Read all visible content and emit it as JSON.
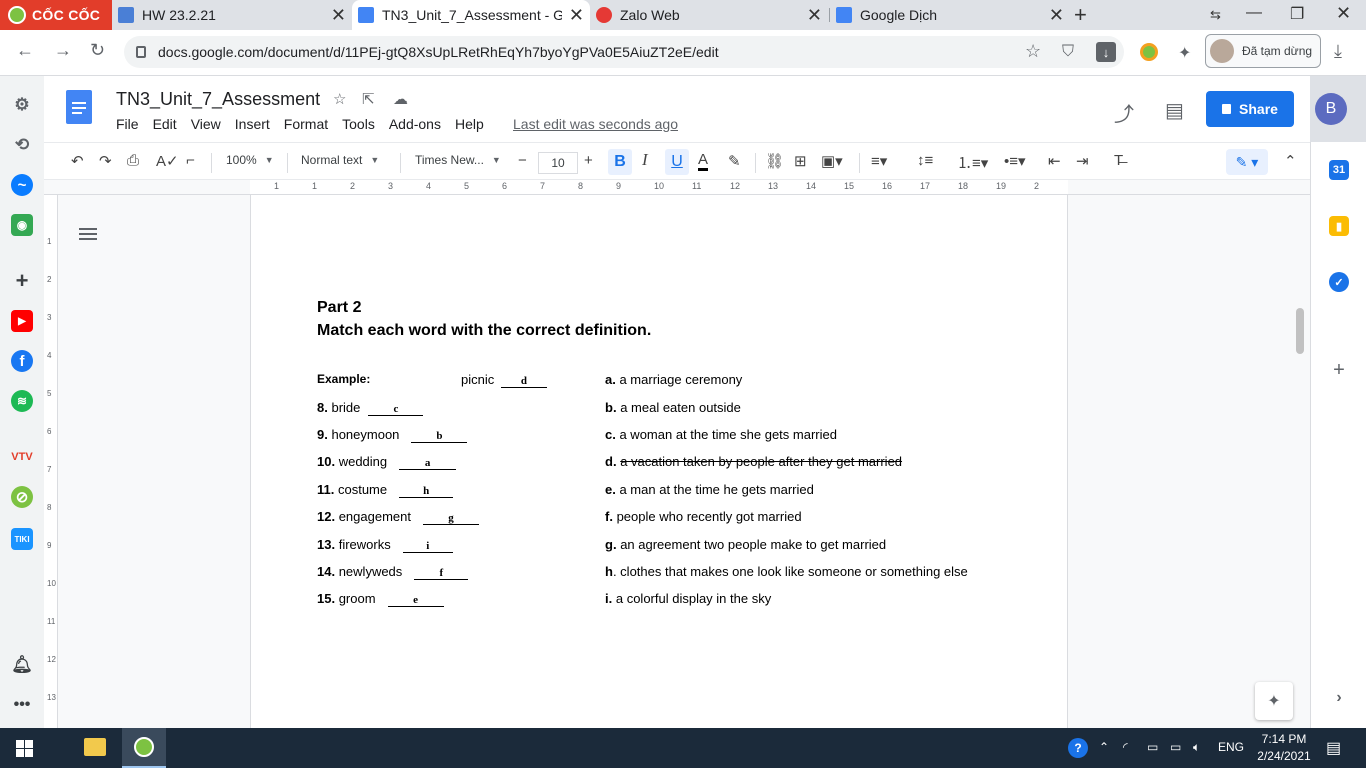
{
  "browser": {
    "brand": "CỐC CỐC",
    "tabs": [
      {
        "title": "HW 23.2.21",
        "active": false
      },
      {
        "title": "TN3_Unit_7_Assessment - Goo",
        "active": true
      },
      {
        "title": "Zalo Web",
        "active": false
      },
      {
        "title": "Google Dịch",
        "active": false
      }
    ],
    "url": "docs.google.com/document/d/11PEj-gtQ8XsUpLRetRhEqYh7byoYgPVa0E5AiuZT2eE/edit",
    "profile_status": "Đã tạm dừng"
  },
  "docs": {
    "title": "TN3_Unit_7_Assessment",
    "menu": [
      "File",
      "Edit",
      "View",
      "Insert",
      "Format",
      "Tools",
      "Add-ons",
      "Help"
    ],
    "last_edit": "Last edit was seconds ago",
    "share_label": "Share",
    "avatar_letter": "B",
    "toolbar": {
      "zoom": "100%",
      "style": "Normal text",
      "font": "Times New...",
      "font_size": "10"
    },
    "ruler_numbers": [
      "1",
      "1",
      "2",
      "3",
      "4",
      "5",
      "6",
      "7",
      "8",
      "9",
      "10",
      "11",
      "12",
      "13",
      "14",
      "15",
      "16",
      "17",
      "18",
      "19",
      "2"
    ],
    "vruler_numbers": [
      "1",
      "2",
      "3",
      "4",
      "5",
      "6",
      "7",
      "8",
      "9",
      "10",
      "11",
      "12",
      "13"
    ]
  },
  "document": {
    "part_heading": "Part 2",
    "instruction": "Match each word with the correct definition.",
    "example": {
      "label": "Example:",
      "word": "picnic",
      "answer": "d"
    },
    "items": [
      {
        "num": "8.",
        "word": "bride",
        "answer": "c"
      },
      {
        "num": "9.",
        "word": "honeymoon",
        "answer": "b"
      },
      {
        "num": "10.",
        "word": "wedding",
        "answer": "a"
      },
      {
        "num": "11.",
        "word": "costume",
        "answer": "h"
      },
      {
        "num": "12.",
        "word": "engagement",
        "answer": "g"
      },
      {
        "num": "13.",
        "word": "fireworks",
        "answer": "i"
      },
      {
        "num": "14.",
        "word": "newlyweds",
        "answer": "f"
      },
      {
        "num": "15.",
        "word": "groom",
        "answer": "e"
      }
    ],
    "definitions": [
      {
        "letter": "a.",
        "text": "a marriage ceremony",
        "struck": false
      },
      {
        "letter": "b.",
        "text": "a meal eaten outside",
        "struck": false
      },
      {
        "letter": "c.",
        "text": "a woman at the time she gets married",
        "struck": false
      },
      {
        "letter": "d.",
        "text": "a vacation taken by people after they get married",
        "struck": true
      },
      {
        "letter": "e.",
        "text": "a man at the time he gets married",
        "struck": false
      },
      {
        "letter": "f.",
        "text": "people who recently got married",
        "struck": false
      },
      {
        "letter": "g.",
        "text": "an agreement two people make to get married",
        "struck": false
      },
      {
        "letter": "h",
        "text": ". clothes that makes one look like someone or something else",
        "struck": false
      },
      {
        "letter": "i.",
        "text": "a colorful display in the sky",
        "struck": false
      }
    ]
  },
  "taskbar": {
    "time": "7:14 PM",
    "date": "2/24/2021",
    "language": "ENG"
  },
  "colors": {
    "docs_blue": "#4285f4",
    "share_blue": "#1a73e8",
    "coccoc_red": "#e23d2a",
    "taskbar": "#1b2a3a"
  },
  "icons": [
    "undo-icon",
    "redo-icon",
    "print-icon",
    "spellcheck-icon",
    "paint-format-icon",
    "link-icon",
    "comment-icon",
    "image-icon",
    "align-icon",
    "line-spacing-icon",
    "numbered-list-icon",
    "bulleted-list-icon",
    "indent-icon",
    "clear-format-icon",
    "pencil-icon"
  ]
}
